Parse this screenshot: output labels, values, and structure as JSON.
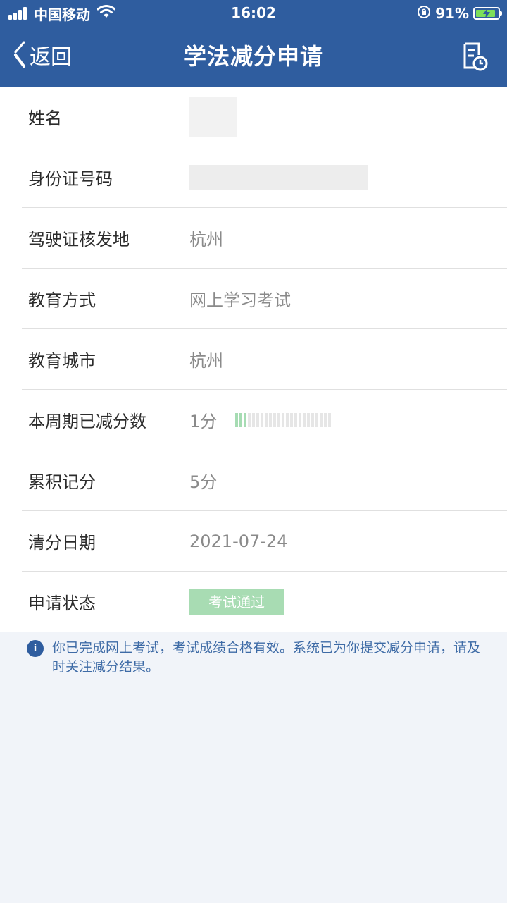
{
  "status_bar": {
    "carrier": "中国移动",
    "time": "16:02",
    "battery_percent": "91%",
    "battery_level": 0.91,
    "icons": [
      "signal-icon",
      "wifi-icon",
      "orientation-lock-icon",
      "battery-charging-icon"
    ]
  },
  "nav": {
    "back_label": "返回",
    "title": "学法减分申请",
    "right_icon": "record-history-icon"
  },
  "form": {
    "name_label": "姓名",
    "id_label": "身份证号码",
    "license_place_label": "驾驶证核发地",
    "license_place_value": "杭州",
    "education_method_label": "教育方式",
    "education_method_value": "网上学习考试",
    "education_city_label": "教育城市",
    "education_city_value": "杭州",
    "deducted_label": "本周期已减分数",
    "deducted_value": "1分",
    "deducted_progress_fraction": 0.0833,
    "accumulated_label": "累积记分",
    "accumulated_value": "5分",
    "clear_date_label": "清分日期",
    "clear_date_value": "2021-07-24",
    "status_label": "申请状态",
    "status_value": "考试通过"
  },
  "notice": {
    "text": "你已完成网上考试，考试成绩合格有效。系统已为你提交减分申请，请及时关注减分结果。"
  },
  "colors": {
    "header_bg": "#2f5d9f",
    "page_bg": "#f1f4f9",
    "status_badge": "#a8dcb3",
    "notice_text": "#3e6ba6"
  }
}
